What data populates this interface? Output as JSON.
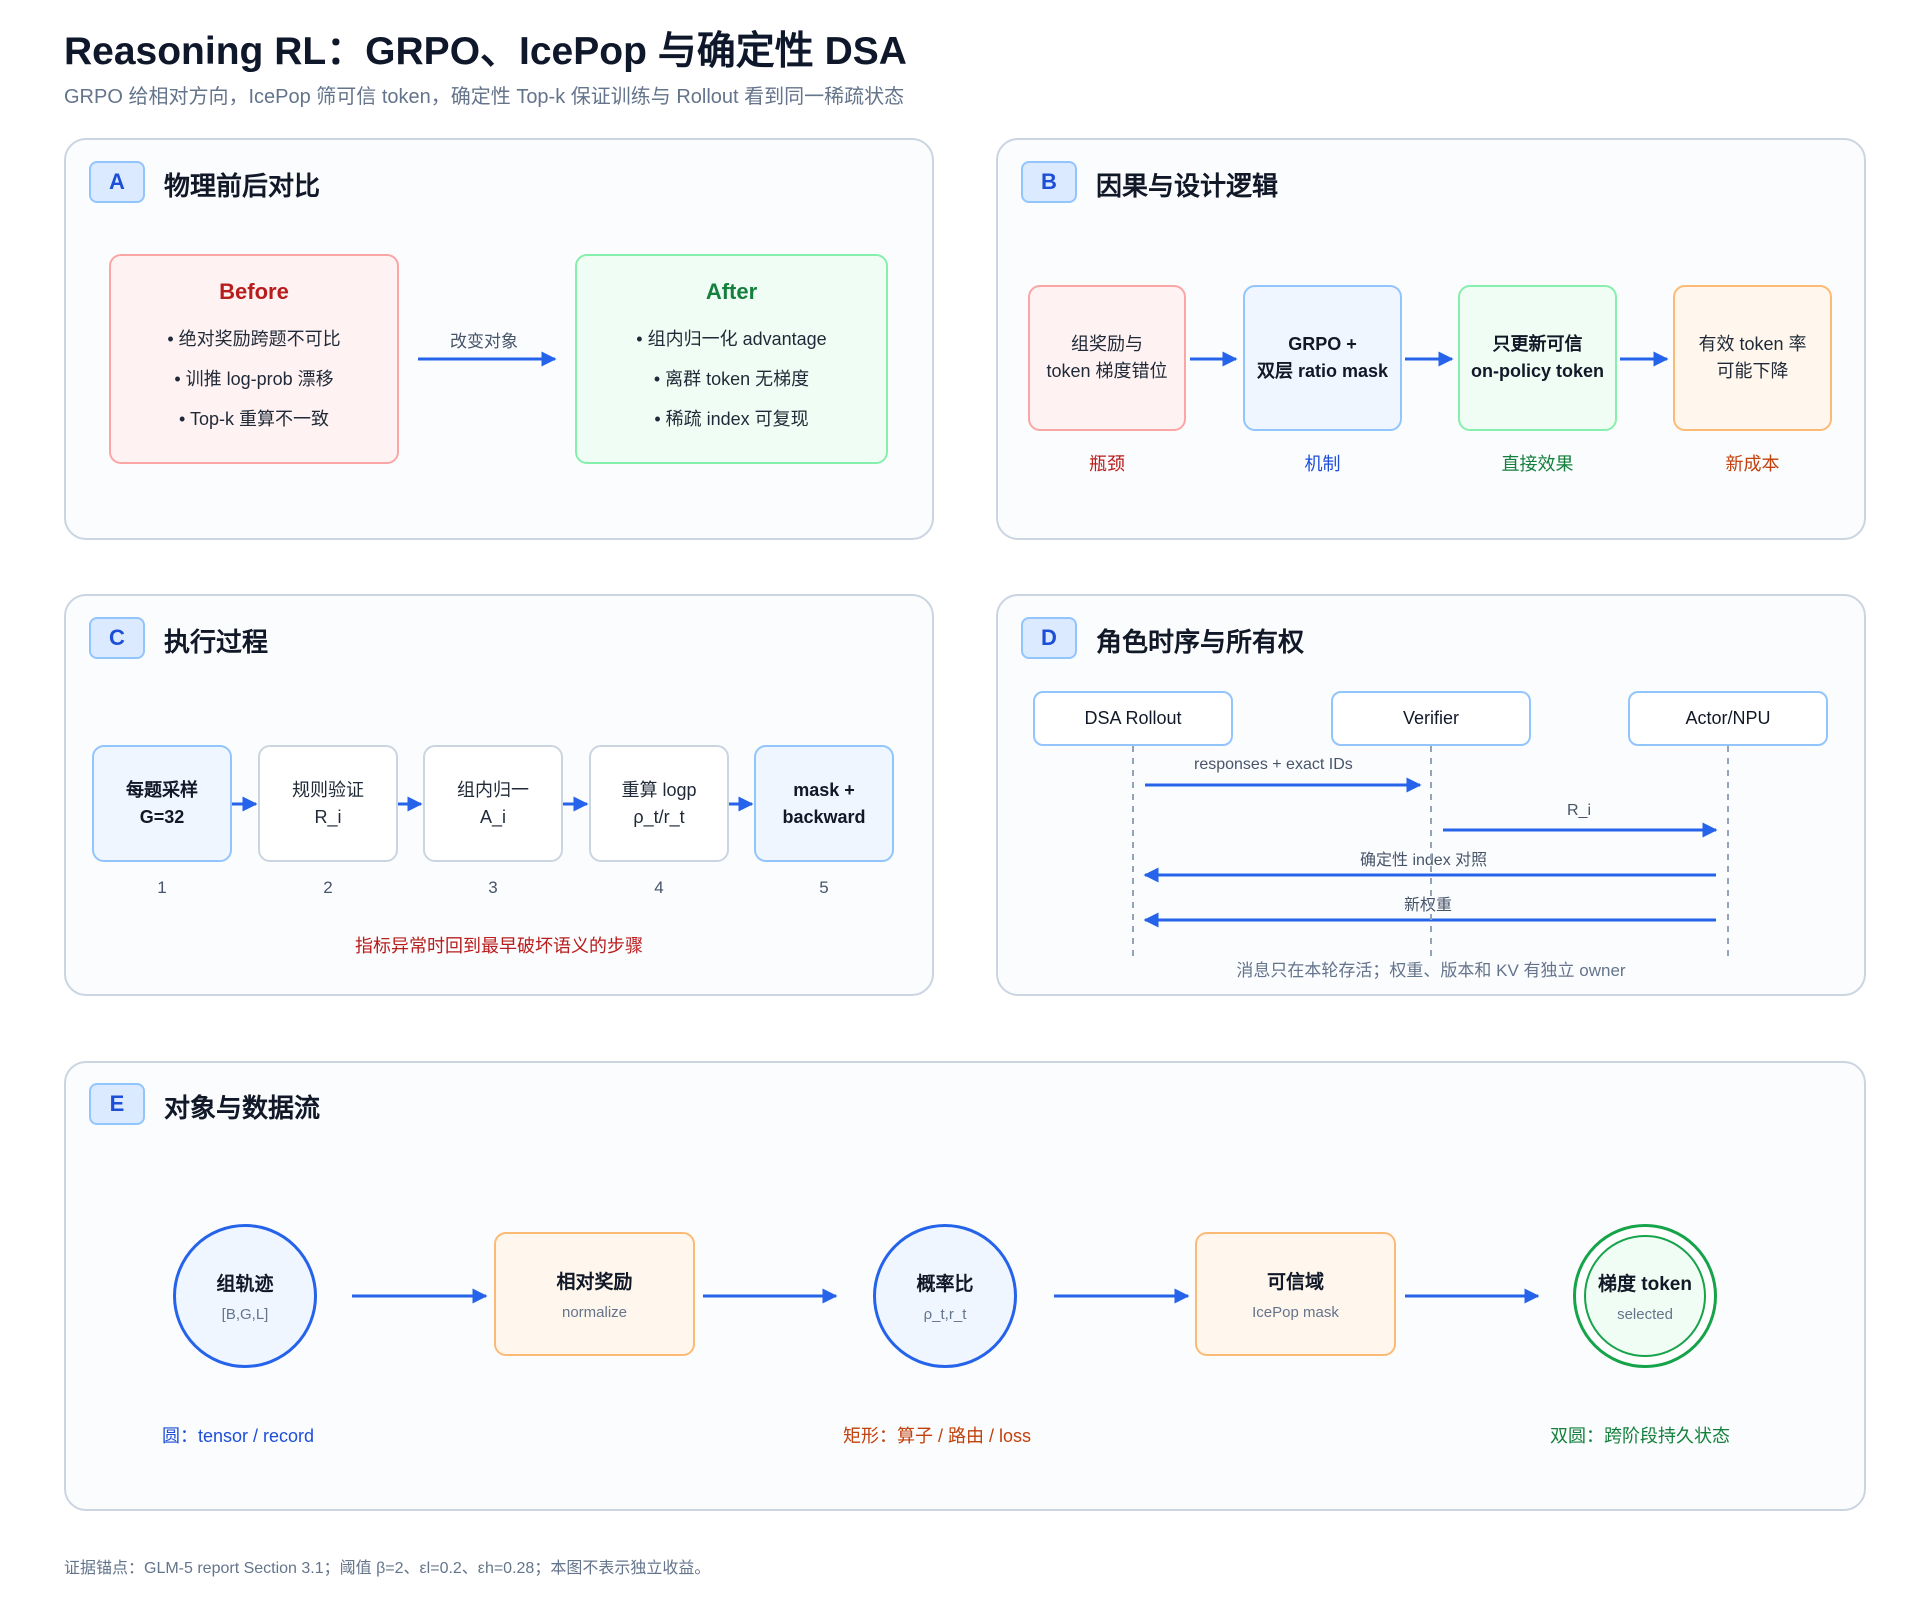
{
  "header": {
    "title": "Reasoning RL：GRPO、IcePop 与确定性 DSA",
    "subtitle": "GRPO 给相对方向，IcePop 筛可信 token，确定性 Top-k 保证训练与 Rollout 看到同一稀疏状态"
  },
  "panel_a": {
    "badge": "A",
    "title": "物理前后对比",
    "before": {
      "heading": "Before",
      "items": [
        "• 绝对奖励跨题不可比",
        "• 训推 log-prob 漂移",
        "• Top-k 重算不一致"
      ]
    },
    "arrow_label": "改变对象",
    "after": {
      "heading": "After",
      "items": [
        "• 组内归一化 advantage",
        "• 离群 token 无梯度",
        "• 稀疏 index 可复现"
      ]
    }
  },
  "panel_b": {
    "badge": "B",
    "title": "因果与设计逻辑",
    "steps": [
      {
        "lines": [
          "组奖励与",
          "token 梯度错位"
        ],
        "caption": "瓶颈"
      },
      {
        "lines": [
          "GRPO +",
          "双层 ratio mask"
        ],
        "caption": "机制"
      },
      {
        "lines": [
          "只更新可信",
          "on-policy token"
        ],
        "caption": "直接效果"
      },
      {
        "lines": [
          "有效 token 率",
          "可能下降"
        ],
        "caption": "新成本"
      }
    ]
  },
  "panel_c": {
    "badge": "C",
    "title": "执行过程",
    "steps": [
      {
        "lines": [
          "每题采样",
          "G=32"
        ],
        "num": "1"
      },
      {
        "lines": [
          "规则验证",
          "R_i"
        ],
        "num": "2"
      },
      {
        "lines": [
          "组内归一",
          "A_i"
        ],
        "num": "3"
      },
      {
        "lines": [
          "重算 logp",
          "ρ_t/r_t"
        ],
        "num": "4"
      },
      {
        "lines": [
          "mask +",
          "backward"
        ],
        "num": "5"
      }
    ],
    "note": "指标异常时回到最早破坏语义的步骤"
  },
  "panel_d": {
    "badge": "D",
    "title": "角色时序与所有权",
    "roles": [
      "DSA Rollout",
      "Verifier",
      "Actor/NPU"
    ],
    "messages": [
      "responses + exact IDs",
      "R_i",
      "确定性 index 对照",
      "新权重"
    ],
    "note": "消息只在本轮存活；权重、版本和 KV 有独立 owner"
  },
  "panel_e": {
    "badge": "E",
    "title": "对象与数据流",
    "nodes": [
      {
        "main": "组轨迹",
        "sub": "[B,G,L]"
      },
      {
        "main": "相对奖励",
        "sub": "normalize"
      },
      {
        "main": "概率比",
        "sub": "ρ_t,r_t"
      },
      {
        "main": "可信域",
        "sub": "IcePop mask"
      },
      {
        "main": "梯度 token",
        "sub": "selected"
      }
    ],
    "legend": [
      "圆：tensor / record",
      "矩形：算子 / 路由 / loss",
      "双圆：跨阶段持久状态"
    ]
  },
  "footer": "证据锚点：GLM-5 report Section 3.1；阈值 β=2、εl=0.2、εh=0.28；本图不表示独立收益。",
  "colors": {
    "arrow": "#2563eb",
    "red": "#b91c1c",
    "green": "#15803d",
    "blue": "#1d4ed8",
    "orange": "#c2410c"
  }
}
